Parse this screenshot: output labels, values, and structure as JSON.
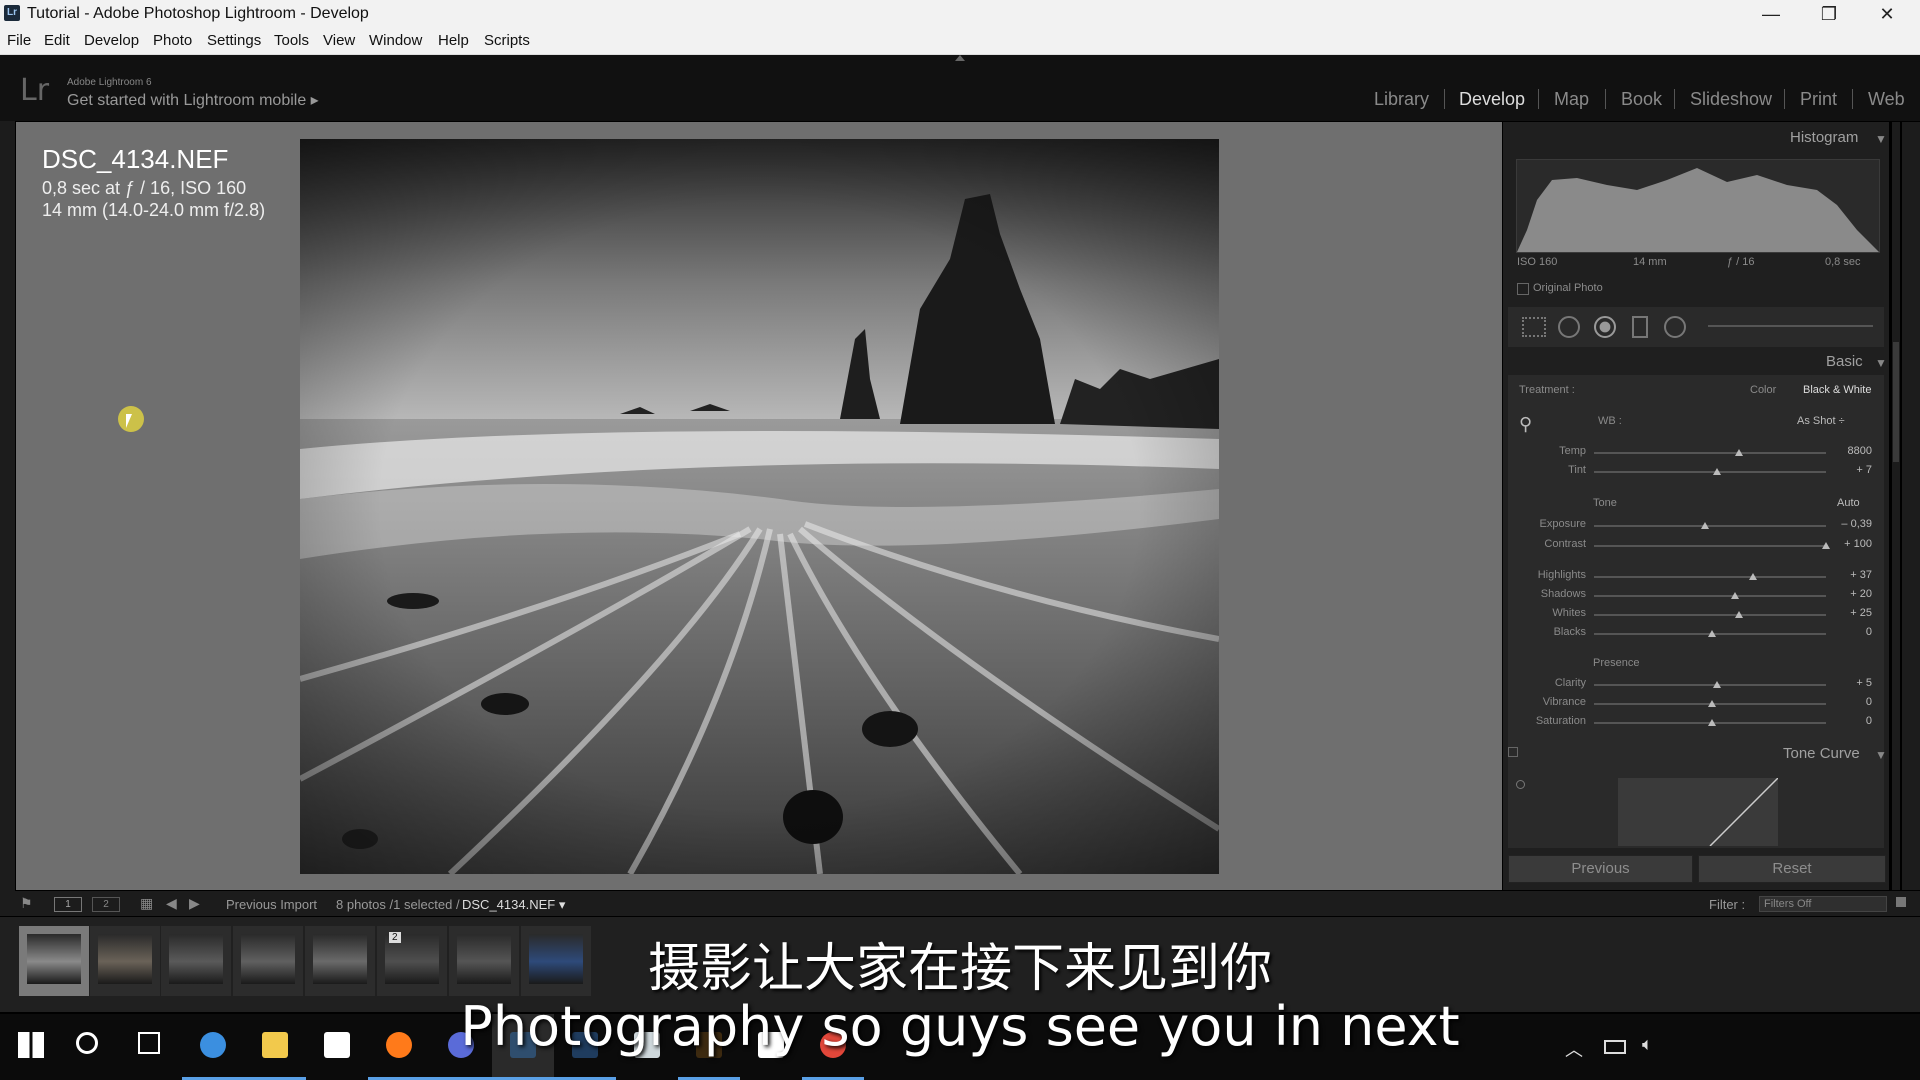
{
  "window": {
    "app_icon": "Lr",
    "title": "Tutorial - Adobe Photoshop Lightroom - Develop",
    "minimize": "—",
    "maximize": "❐",
    "close": "✕"
  },
  "menubar": [
    "File",
    "Edit",
    "Develop",
    "Photo",
    "Settings",
    "Tools",
    "View",
    "Window",
    "Help",
    "Scripts"
  ],
  "header": {
    "logo": "Lr",
    "version": "Adobe Lightroom 6",
    "mobile_prompt": "Get started with Lightroom mobile ▸",
    "modules": [
      "Library",
      "Develop",
      "Map",
      "Book",
      "Slideshow",
      "Print",
      "Web"
    ],
    "active_module": "Develop"
  },
  "photo_info": {
    "filename": "DSC_4134.NEF",
    "exposure_line": "0,8 sec at ƒ / 16, ISO 160",
    "lens_line": "14 mm (14.0-24.0 mm f/2.8)"
  },
  "histogram": {
    "title": "Histogram",
    "iso": "ISO 160",
    "focal": "14 mm",
    "aperture": "ƒ / 16",
    "shutter": "0,8 sec",
    "original_photo": "Original Photo"
  },
  "basic": {
    "title": "Basic",
    "treatment_label": "Treatment :",
    "treatment_color": "Color",
    "treatment_bw": "Black & White",
    "wb_label": "WB :",
    "wb_value": "As Shot ÷",
    "tone_label": "Tone",
    "auto_label": "Auto",
    "presence_label": "Presence",
    "sliders": [
      {
        "label": "Temp",
        "value": "8800",
        "position": 0.62
      },
      {
        "label": "Tint",
        "value": "+ 7",
        "position": 0.52
      },
      {
        "label": "Exposure",
        "value": "– 0,39",
        "position": 0.47
      },
      {
        "label": "Contrast",
        "value": "+ 100",
        "position": 1.0
      },
      {
        "label": "Highlights",
        "value": "+ 37",
        "position": 0.68
      },
      {
        "label": "Shadows",
        "value": "+ 20",
        "position": 0.6
      },
      {
        "label": "Whites",
        "value": "+ 25",
        "position": 0.62
      },
      {
        "label": "Blacks",
        "value": "0",
        "position": 0.5
      },
      {
        "label": "Clarity",
        "value": "+ 5",
        "position": 0.52
      },
      {
        "label": "Vibrance",
        "value": "0",
        "position": 0.5
      },
      {
        "label": "Saturation",
        "value": "0",
        "position": 0.5
      }
    ]
  },
  "tone_curve": {
    "title": "Tone Curve"
  },
  "buttons": {
    "previous": "Previous",
    "reset": "Reset"
  },
  "filmstrip_toolbar": {
    "view1": "1",
    "view2": "2",
    "source": "Previous Import",
    "count_prefix": "8 photos /1 selected /",
    "selected_file": "DSC_4134.NEF ▾",
    "filter_label": "Filter :",
    "filter_value": "Filters Off"
  },
  "filmstrip": {
    "thumbnails": [
      {
        "name": "thumb-1",
        "tone": "#8a8a8a",
        "selected": true
      },
      {
        "name": "thumb-2",
        "tone": "#6a6258",
        "selected": false
      },
      {
        "name": "thumb-3",
        "tone": "#5a5a5a",
        "selected": false
      },
      {
        "name": "thumb-4",
        "tone": "#606060",
        "selected": false
      },
      {
        "name": "thumb-5",
        "tone": "#6a6a6a",
        "selected": false
      },
      {
        "name": "thumb-6",
        "tone": "#4f4f4f",
        "selected": false
      },
      {
        "name": "thumb-7",
        "tone": "#555555",
        "selected": false
      },
      {
        "name": "thumb-8",
        "tone": "#2e4a7a",
        "selected": false
      }
    ],
    "stack_badge": "2"
  },
  "subtitles": {
    "chinese": "摄影让大家在接下来见到你",
    "english": "Photography so guys see you in next"
  },
  "taskbar": {
    "icons": [
      "windows-start-icon",
      "search-icon",
      "task-view-icon",
      "edge-icon",
      "file-explorer-icon",
      "store-icon",
      "firefox-icon",
      "settings-icon",
      "lightroom-icon",
      "photoshop-icon",
      "notepad-icon",
      "bridge-icon",
      "mail-icon",
      "chrome-icon"
    ],
    "active_icon": "lightroom-icon"
  },
  "colors": {
    "viewer_bg": "#6f6f6f",
    "panel_bg": "#1f1f1f",
    "taskbar_accent": "#5aa0e6"
  }
}
